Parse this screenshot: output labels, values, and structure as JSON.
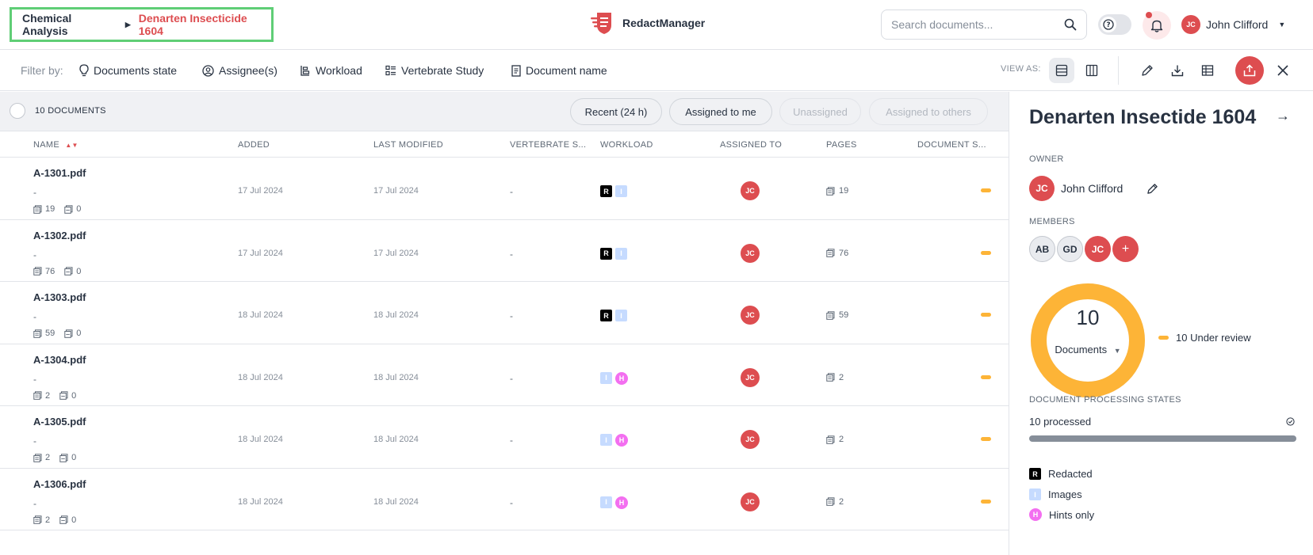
{
  "breadcrumb": {
    "parent": "Chemical Analysis",
    "current": "Denarten Insecticide 1604"
  },
  "app": {
    "name": "RedactManager"
  },
  "search": {
    "placeholder": "Search documents..."
  },
  "user": {
    "initials": "JC",
    "name": "John Clifford"
  },
  "filters": {
    "label": "Filter by:",
    "items": [
      "Documents state",
      "Assignee(s)",
      "Workload",
      "Vertebrate Study",
      "Document name"
    ]
  },
  "view_as": "VIEW AS:",
  "list": {
    "count_label": "10 DOCUMENTS",
    "quick_filters": [
      "Recent (24 h)",
      "Assigned to me",
      "Unassigned",
      "Assigned to others"
    ],
    "columns": [
      "NAME",
      "ADDED",
      "LAST MODIFIED",
      "VERTEBRATE S...",
      "WORKLOAD",
      "ASSIGNED TO",
      "PAGES",
      "DOCUMENT S..."
    ],
    "rows": [
      {
        "name": "A-1301.pdf",
        "dash": "-",
        "pages_meta": "19",
        "excl_meta": "0",
        "added": "17 Jul 2024",
        "modified": "17 Jul 2024",
        "vertebrate": "-",
        "assignee": "JC",
        "pages": "19",
        "workload": [
          "R",
          "I"
        ]
      },
      {
        "name": "A-1302.pdf",
        "dash": "-",
        "pages_meta": "76",
        "excl_meta": "0",
        "added": "17 Jul 2024",
        "modified": "17 Jul 2024",
        "vertebrate": "-",
        "assignee": "JC",
        "pages": "76",
        "workload": [
          "R",
          "I"
        ]
      },
      {
        "name": "A-1303.pdf",
        "dash": "-",
        "pages_meta": "59",
        "excl_meta": "0",
        "added": "18 Jul 2024",
        "modified": "18 Jul 2024",
        "vertebrate": "-",
        "assignee": "JC",
        "pages": "59",
        "workload": [
          "R",
          "I"
        ]
      },
      {
        "name": "A-1304.pdf",
        "dash": "-",
        "pages_meta": "2",
        "excl_meta": "0",
        "added": "18 Jul 2024",
        "modified": "18 Jul 2024",
        "vertebrate": "-",
        "assignee": "JC",
        "pages": "2",
        "workload": [
          "I",
          "H"
        ]
      },
      {
        "name": "A-1305.pdf",
        "dash": "-",
        "pages_meta": "2",
        "excl_meta": "0",
        "added": "18 Jul 2024",
        "modified": "18 Jul 2024",
        "vertebrate": "-",
        "assignee": "JC",
        "pages": "2",
        "workload": [
          "I",
          "H"
        ]
      },
      {
        "name": "A-1306.pdf",
        "dash": "-",
        "pages_meta": "2",
        "excl_meta": "0",
        "added": "18 Jul 2024",
        "modified": "18 Jul 2024",
        "vertebrate": "-",
        "assignee": "JC",
        "pages": "2",
        "workload": [
          "I",
          "H"
        ]
      }
    ]
  },
  "panel": {
    "title": "Denarten Insectide 1604",
    "owner_label": "OWNER",
    "owner": {
      "initials": "JC",
      "name": "John Clifford"
    },
    "members_label": "MEMBERS",
    "members": [
      "AB",
      "GD",
      "JC"
    ],
    "add_member": "+",
    "donut": {
      "total": "10",
      "label": "Documents",
      "legend": "10 Under review",
      "under_review_fraction": 1.0
    },
    "processing_label": "DOCUMENT PROCESSING STATES",
    "processed": "10 processed",
    "processed_fraction": 1.0,
    "legend": [
      {
        "tag": "R",
        "label": "Redacted"
      },
      {
        "tag": "I",
        "label": "Images"
      },
      {
        "tag": "H",
        "label": "Hints only"
      }
    ]
  },
  "colors": {
    "accent": "#dd4d50",
    "under_review": "#fdb437",
    "highlight_border": "#5fce76"
  }
}
